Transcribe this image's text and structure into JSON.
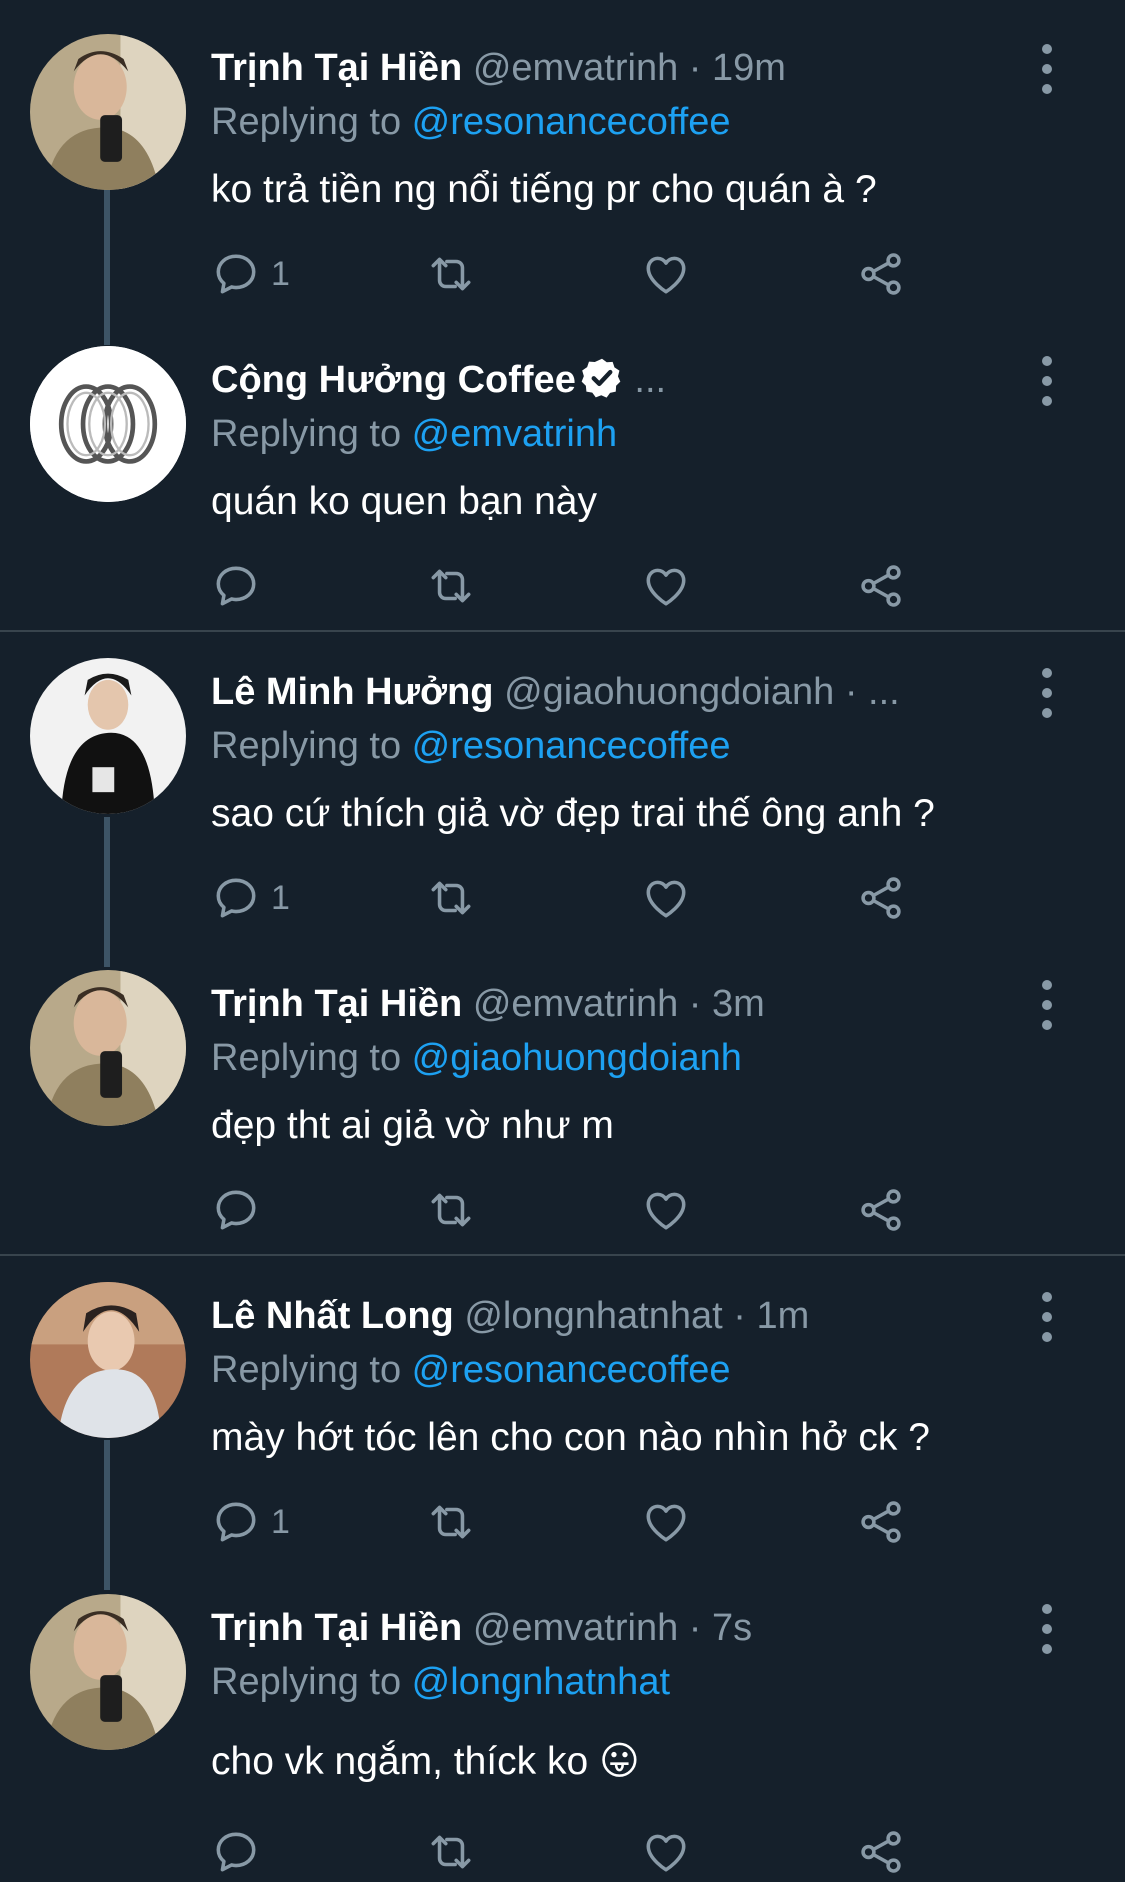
{
  "tweets": [
    {
      "name": "Trịnh Tại Hiền",
      "handle": "@emvatrinh",
      "sep": " · ",
      "time": "19m",
      "replying_prefix": "Replying to ",
      "replying_to": "@resonancecoffee",
      "text": "ko trả tiền ng nổi tiếng pr cho quán à ?",
      "reply_count": "1"
    },
    {
      "name": "Cộng Hưởng Coffee",
      "handle": "",
      "sep": " ...",
      "time": "",
      "replying_prefix": "Replying to ",
      "replying_to": "@emvatrinh",
      "text": "quán ko quen bạn này",
      "reply_count": ""
    },
    {
      "name": "Lê Minh Hưởng",
      "handle": "@giaohuongdoianh",
      "sep": " · ...",
      "time": "",
      "replying_prefix": "Replying to ",
      "replying_to": "@resonancecoffee",
      "text": "sao cứ thích giả vờ đẹp trai thế ông anh ?",
      "reply_count": "1"
    },
    {
      "name": "Trịnh Tại Hiền",
      "handle": "@emvatrinh",
      "sep": " · ",
      "time": "3m",
      "replying_prefix": "Replying to ",
      "replying_to": "@giaohuongdoianh",
      "text": "đẹp tht ai giả vờ như m",
      "reply_count": ""
    },
    {
      "name": "Lê Nhất Long",
      "handle": "@longnhatnhat",
      "sep": " · ",
      "time": "1m",
      "replying_prefix": "Replying to ",
      "replying_to": "@resonancecoffee",
      "text": "mày hớt tóc lên cho con nào nhìn hở ck ?",
      "reply_count": "1"
    },
    {
      "name": "Trịnh Tại Hiền",
      "handle": "@emvatrinh",
      "sep": " · ",
      "time": "7s",
      "replying_prefix": "Replying to ",
      "replying_to": "@longnhatnhat",
      "text": "cho vk ngắm, thíck ko 😛",
      "reply_count": ""
    }
  ],
  "colors": {
    "background": "#15202b",
    "secondary_text": "#8899a6",
    "link": "#1da1f2",
    "divider": "#38444d"
  },
  "icons": [
    "reply-icon",
    "retweet-icon",
    "like-icon",
    "share-icon",
    "more-icon",
    "verified-badge-icon"
  ]
}
